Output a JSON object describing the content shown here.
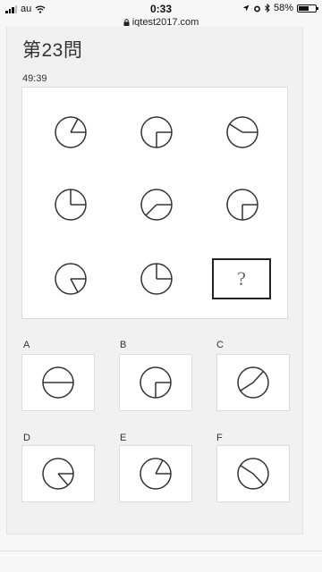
{
  "status_bar": {
    "carrier": "au",
    "time": "0:33",
    "url": "iqtest2017.com",
    "battery": "58%"
  },
  "question": {
    "title": "第23問",
    "timer": "49:39",
    "unknown_symbol": "?"
  },
  "options": [
    {
      "label": "A"
    },
    {
      "label": "B"
    },
    {
      "label": "C"
    },
    {
      "label": "D"
    },
    {
      "label": "E"
    },
    {
      "label": "F"
    }
  ]
}
